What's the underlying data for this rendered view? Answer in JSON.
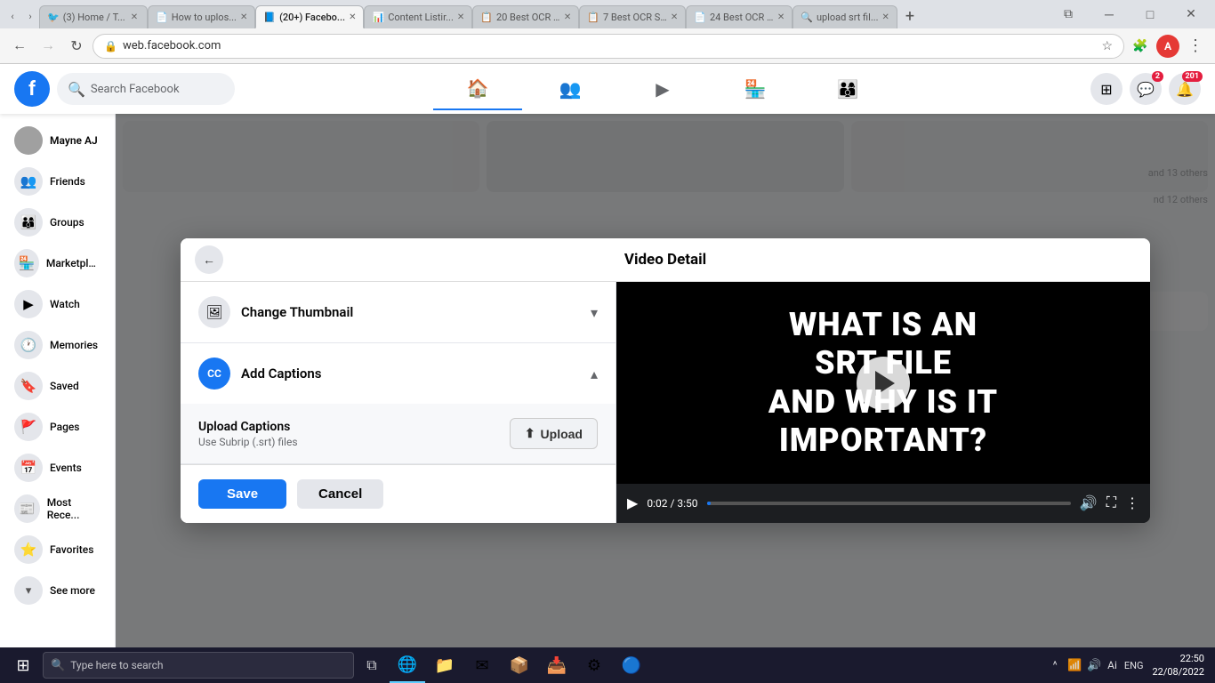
{
  "browser": {
    "tabs": [
      {
        "id": "t1",
        "favicon": "🐦",
        "label": "(3) Home / T...",
        "active": false,
        "color": "#1da1f2"
      },
      {
        "id": "t2",
        "favicon": "📄",
        "label": "How to uplos...",
        "active": false,
        "color": "#4285f4"
      },
      {
        "id": "t3",
        "favicon": "📘",
        "label": "(20+) Facebo...",
        "active": true,
        "color": "#1877f2"
      },
      {
        "id": "t4",
        "favicon": "📊",
        "label": "Content Listir...",
        "active": false,
        "color": "#0f9d58"
      },
      {
        "id": "t5",
        "favicon": "📋",
        "label": "20 Best OCR ...",
        "active": false,
        "color": "#ea4335"
      },
      {
        "id": "t6",
        "favicon": "📋",
        "label": "7 Best OCR S...",
        "active": false,
        "color": "#ea4335"
      },
      {
        "id": "t7",
        "favicon": "📄",
        "label": "24 Best OCR ...",
        "active": false,
        "color": "#555"
      },
      {
        "id": "t8",
        "favicon": "🔍",
        "label": "upload srt fil...",
        "active": false,
        "color": "#4285f4"
      }
    ],
    "url": "web.facebook.com"
  },
  "facebook": {
    "logo": "f",
    "search_placeholder": "Search Facebook",
    "nav_items": [
      {
        "id": "home",
        "icon": "🏠",
        "active": true
      },
      {
        "id": "friends",
        "icon": "👥",
        "active": false
      },
      {
        "id": "video",
        "icon": "▶",
        "active": false
      },
      {
        "id": "store",
        "icon": "🏪",
        "active": false
      },
      {
        "id": "groups",
        "icon": "👨‍👩‍👦",
        "active": false
      }
    ],
    "header_actions": {
      "apps_icon": "⊞",
      "messenger_icon": "💬",
      "messenger_badge": "2",
      "notifications_icon": "🔔",
      "notifications_badge": "201"
    },
    "sidebar": {
      "items": [
        {
          "id": "profile",
          "label": "Mayne AJ",
          "icon_type": "avatar"
        },
        {
          "id": "friends",
          "label": "Friends",
          "icon": "👥"
        },
        {
          "id": "groups",
          "label": "Groups",
          "icon": "👨‍👩‍👦"
        },
        {
          "id": "marketplace",
          "label": "Marketplac...",
          "icon": "🏪"
        },
        {
          "id": "watch",
          "label": "Watch",
          "icon": "▶"
        },
        {
          "id": "memories",
          "label": "Memories",
          "icon": "🕐"
        },
        {
          "id": "saved",
          "label": "Saved",
          "icon": "🔖"
        },
        {
          "id": "pages",
          "label": "Pages",
          "icon": "🚩"
        },
        {
          "id": "events",
          "label": "Events",
          "icon": "📅"
        },
        {
          "id": "mostrece",
          "label": "Most Rece...",
          "icon": "📰"
        },
        {
          "id": "favorites",
          "label": "Favorites",
          "icon": "⭐"
        },
        {
          "id": "seemore",
          "label": "See more",
          "icon": "⌄"
        }
      ]
    }
  },
  "dialog": {
    "title": "Video Detail",
    "back_btn_label": "←",
    "accordion": {
      "change_thumbnail": {
        "label": "Change Thumbnail",
        "icon": "🖼",
        "chevron_collapsed": "▾",
        "expanded": false
      },
      "add_captions": {
        "label": "Add Captions",
        "icon": "CC",
        "chevron_collapsed": "▴",
        "expanded": true,
        "upload_section": {
          "title": "Upload Captions",
          "subtitle": "Use Subrip (.srt) files",
          "upload_btn_label": "Upload",
          "upload_icon": "⬆"
        }
      }
    },
    "save_btn": "Save",
    "cancel_btn": "Cancel",
    "video": {
      "title_line1": "WHAT IS AN",
      "title_line2": "SRT FILE",
      "title_line3": "AND WHY IS IT",
      "title_line4": "IMPORTANT?",
      "current_time": "0:02",
      "total_time": "3:50",
      "progress_pct": 1
    }
  },
  "taskbar": {
    "search_placeholder": "Type here to search",
    "search_icon": "🔍",
    "apps": [
      {
        "id": "start",
        "icon": "⊞"
      },
      {
        "id": "edge",
        "icon": "🌐"
      },
      {
        "id": "explorer",
        "icon": "📁"
      },
      {
        "id": "mail",
        "icon": "✉"
      },
      {
        "id": "amazon",
        "icon": "📦"
      },
      {
        "id": "dropbox",
        "icon": "📥"
      },
      {
        "id": "settings",
        "icon": "⚙"
      },
      {
        "id": "chrome",
        "icon": "🔵"
      }
    ],
    "tray": {
      "caret_up": "^",
      "network": "📶",
      "volume": "🔊",
      "ai_label": "Ai",
      "time": "22:50",
      "date": "22/08/2022",
      "lang": "ENG"
    }
  }
}
